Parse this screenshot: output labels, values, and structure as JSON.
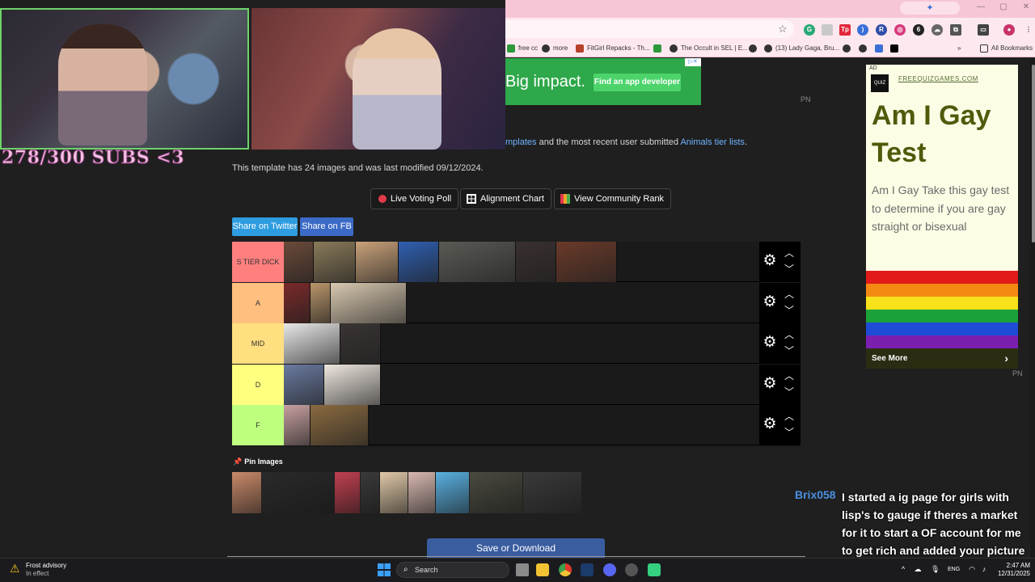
{
  "stream": {
    "subs_counter": "278/300 SUBS <3"
  },
  "browser": {
    "gemini_label": "✦",
    "bookmarks": [
      {
        "label": "free cc"
      },
      {
        "label": "more"
      },
      {
        "label": "FitGirl Repacks - Th..."
      },
      {
        "label": "The Occult in SEL | E..."
      },
      {
        "label": "(13) Lady Gaga, Bru..."
      }
    ],
    "all_bookmarks": "All Bookmarks"
  },
  "banner_ad": {
    "text": "Big impact.",
    "button": "Find an app developer"
  },
  "ad_badge": "PN",
  "intro": {
    "prefix": "mplates",
    "middle": " and the most recent user submitted ",
    "link": "Animals tier lists",
    "suffix": "."
  },
  "template_info": "This template has 24 images and was last modified 09/12/2024.",
  "actions": {
    "live_voting": "Live Voting Poll",
    "alignment": "Alignment Chart",
    "community": "View Community Rank",
    "share_twitter": "Share on Twitter",
    "share_fb": "Share on FB"
  },
  "tiers": [
    {
      "label": "S TIER DICK",
      "color": "#ff7f7f"
    },
    {
      "label": "A",
      "color": "#ffbf7f"
    },
    {
      "label": "MID",
      "color": "#ffdf7f"
    },
    {
      "label": "D",
      "color": "#ffff7f"
    },
    {
      "label": "F",
      "color": "#bfff7f"
    }
  ],
  "pin": {
    "title": "Pin Images",
    "icon": "📌"
  },
  "save_button": "Save or Download",
  "side_ad": {
    "tag": "AD",
    "logo": "QUIZ",
    "domain": "FREEQUIZGAMES.COM",
    "title": "Am I Gay Test",
    "body": "Am I Gay Take this gay test to determine if you are gay straight or bisexual",
    "see_more": "See More"
  },
  "chat": {
    "user": "Brix058",
    "message": "I started a ig page for girls with lisp's to gauge if theres a market for it to start a OF account for me to get rich and added your picture to my page."
  },
  "taskbar": {
    "weather_title": "Frost advisory",
    "weather_sub": "In effect",
    "search": "Search",
    "lang": "ENG",
    "time": "2:47 AM",
    "date": "12/31/2025"
  }
}
